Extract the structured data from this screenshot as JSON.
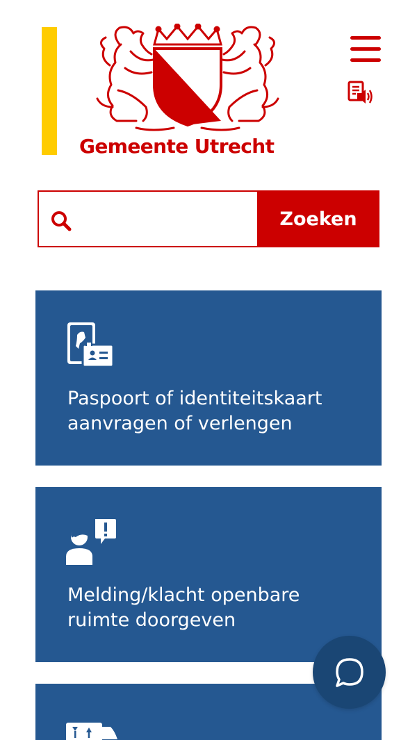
{
  "header": {
    "logo_text": "Gemeente Utrecht",
    "menu_icon": "hamburger-menu-icon",
    "readspeaker_icon": "read-aloud-icon"
  },
  "search": {
    "placeholder": "",
    "value": "",
    "button_label": "Zoeken",
    "icon": "search-icon"
  },
  "tiles": [
    {
      "label": "Paspoort of identiteitskaart aanvragen of verlengen",
      "icon": "passport-id-card-icon"
    },
    {
      "label": "Melding/klacht openbare ruimte doorgeven",
      "icon": "person-report-icon"
    },
    {
      "label": "",
      "icon": "moving-van-icon"
    }
  ],
  "chat": {
    "icon": "chat-bubble-icon"
  },
  "colors": {
    "brand_red": "#cc0000",
    "accent_yellow": "#ffcc00",
    "tile_blue": "#255891",
    "chat_blue": "#1a4674"
  }
}
